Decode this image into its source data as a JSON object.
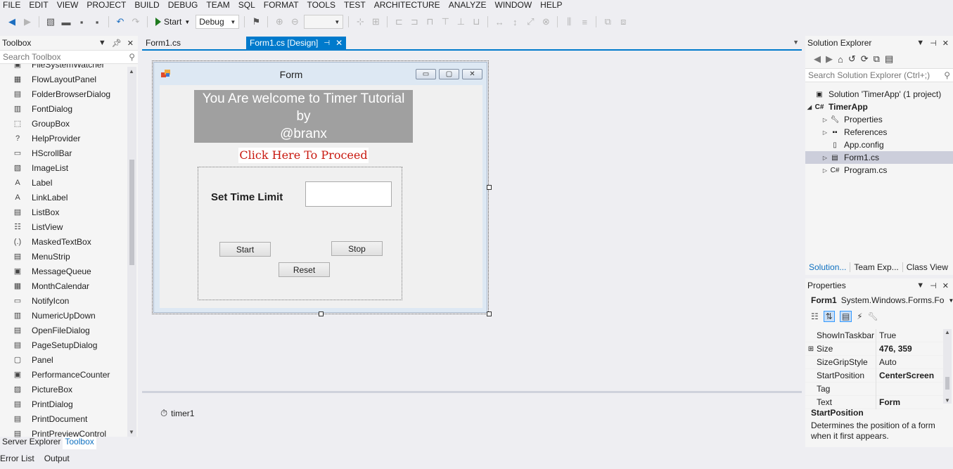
{
  "menu": [
    "FILE",
    "EDIT",
    "VIEW",
    "PROJECT",
    "BUILD",
    "DEBUG",
    "TEAM",
    "SQL",
    "FORMAT",
    "TOOLS",
    "TEST",
    "ARCHITECTURE",
    "ANALYZE",
    "WINDOW",
    "HELP"
  ],
  "toolbar": {
    "start_label": "Start",
    "config": "Debug"
  },
  "toolbox": {
    "title": "Toolbox",
    "search_placeholder": "Search Toolbox",
    "items": [
      {
        "label": "FileSystemWatcher",
        "icon": "filesystemwatcher-icon",
        "glyph": "▣"
      },
      {
        "label": "FlowLayoutPanel",
        "icon": "flowlayoutpanel-icon",
        "glyph": "▦"
      },
      {
        "label": "FolderBrowserDialog",
        "icon": "folderbrowserdialog-icon",
        "glyph": "▤"
      },
      {
        "label": "FontDialog",
        "icon": "fontdialog-icon",
        "glyph": "▥"
      },
      {
        "label": "GroupBox",
        "icon": "groupbox-icon",
        "glyph": "⬚"
      },
      {
        "label": "HelpProvider",
        "icon": "helpprovider-icon",
        "glyph": "?"
      },
      {
        "label": "HScrollBar",
        "icon": "hscrollbar-icon",
        "glyph": "▭"
      },
      {
        "label": "ImageList",
        "icon": "imagelist-icon",
        "glyph": "▧"
      },
      {
        "label": "Label",
        "icon": "label-icon",
        "glyph": "A"
      },
      {
        "label": "LinkLabel",
        "icon": "linklabel-icon",
        "glyph": "A"
      },
      {
        "label": "ListBox",
        "icon": "listbox-icon",
        "glyph": "▤"
      },
      {
        "label": "ListView",
        "icon": "listview-icon",
        "glyph": "☷"
      },
      {
        "label": "MaskedTextBox",
        "icon": "maskedtextbox-icon",
        "glyph": "(.)"
      },
      {
        "label": "MenuStrip",
        "icon": "menustrip-icon",
        "glyph": "▤"
      },
      {
        "label": "MessageQueue",
        "icon": "messagequeue-icon",
        "glyph": "▣"
      },
      {
        "label": "MonthCalendar",
        "icon": "monthcalendar-icon",
        "glyph": "▦"
      },
      {
        "label": "NotifyIcon",
        "icon": "notifyicon-icon",
        "glyph": "▭"
      },
      {
        "label": "NumericUpDown",
        "icon": "numericupdown-icon",
        "glyph": "▥"
      },
      {
        "label": "OpenFileDialog",
        "icon": "openfiledialog-icon",
        "glyph": "▤"
      },
      {
        "label": "PageSetupDialog",
        "icon": "pagesetupdialog-icon",
        "glyph": "▤"
      },
      {
        "label": "Panel",
        "icon": "panel-icon",
        "glyph": "▢"
      },
      {
        "label": "PerformanceCounter",
        "icon": "performancecounter-icon",
        "glyph": "▣"
      },
      {
        "label": "PictureBox",
        "icon": "picturebox-icon",
        "glyph": "▨"
      },
      {
        "label": "PrintDialog",
        "icon": "printdialog-icon",
        "glyph": "▤"
      },
      {
        "label": "PrintDocument",
        "icon": "printdocument-icon",
        "glyph": "▤"
      },
      {
        "label": "PrintPreviewControl",
        "icon": "printpreviewcontrol-icon",
        "glyph": "▤"
      }
    ]
  },
  "bottom_tabs": {
    "server_explorer": "Server Explorer",
    "toolbox": "Toolbox",
    "error_list": "Error List",
    "output": "Output"
  },
  "doc_tabs": {
    "tab1": "Form1.cs",
    "tab2": "Form1.cs [Design]"
  },
  "form": {
    "title": "Form",
    "welcome_line1": "You Are welcome to Timer Tutorial",
    "welcome_line2": "by",
    "welcome_line3": "@branx",
    "proceed": "Click Here To Proceed",
    "set_time_label": "Set Time Limit",
    "start_button": "Start",
    "stop_button": "Stop",
    "reset_button": "Reset"
  },
  "tray": {
    "timer": "timer1"
  },
  "solution_explorer": {
    "title": "Solution Explorer",
    "search_placeholder": "Search Solution Explorer (Ctrl+;)",
    "solution": "Solution 'TimerApp' (1 project)",
    "project": "TimerApp",
    "items": [
      "Properties",
      "References",
      "App.config",
      "Form1.cs",
      "Program.cs"
    ],
    "tabs": [
      "Solution...",
      "Team Exp...",
      "Class View"
    ]
  },
  "properties": {
    "title": "Properties",
    "object_name": "Form1",
    "object_type": "System.Windows.Forms.Fo",
    "rows": [
      {
        "name": "ShowInTaskbar",
        "value": "True",
        "bold": false,
        "expand": ""
      },
      {
        "name": "Size",
        "value": "476, 359",
        "bold": true,
        "expand": "⊞"
      },
      {
        "name": "SizeGripStyle",
        "value": "Auto",
        "bold": false,
        "expand": ""
      },
      {
        "name": "StartPosition",
        "value": "CenterScreen",
        "bold": true,
        "expand": ""
      },
      {
        "name": "Tag",
        "value": "",
        "bold": false,
        "expand": ""
      },
      {
        "name": "Text",
        "value": "Form",
        "bold": true,
        "expand": ""
      }
    ],
    "desc_name": "StartPosition",
    "desc_text": "Determines the position of a form when it first appears."
  },
  "colors": {
    "accent": "#007acc",
    "proceed_text": "#c8180f",
    "welcome_bg": "#a0a0a0"
  }
}
